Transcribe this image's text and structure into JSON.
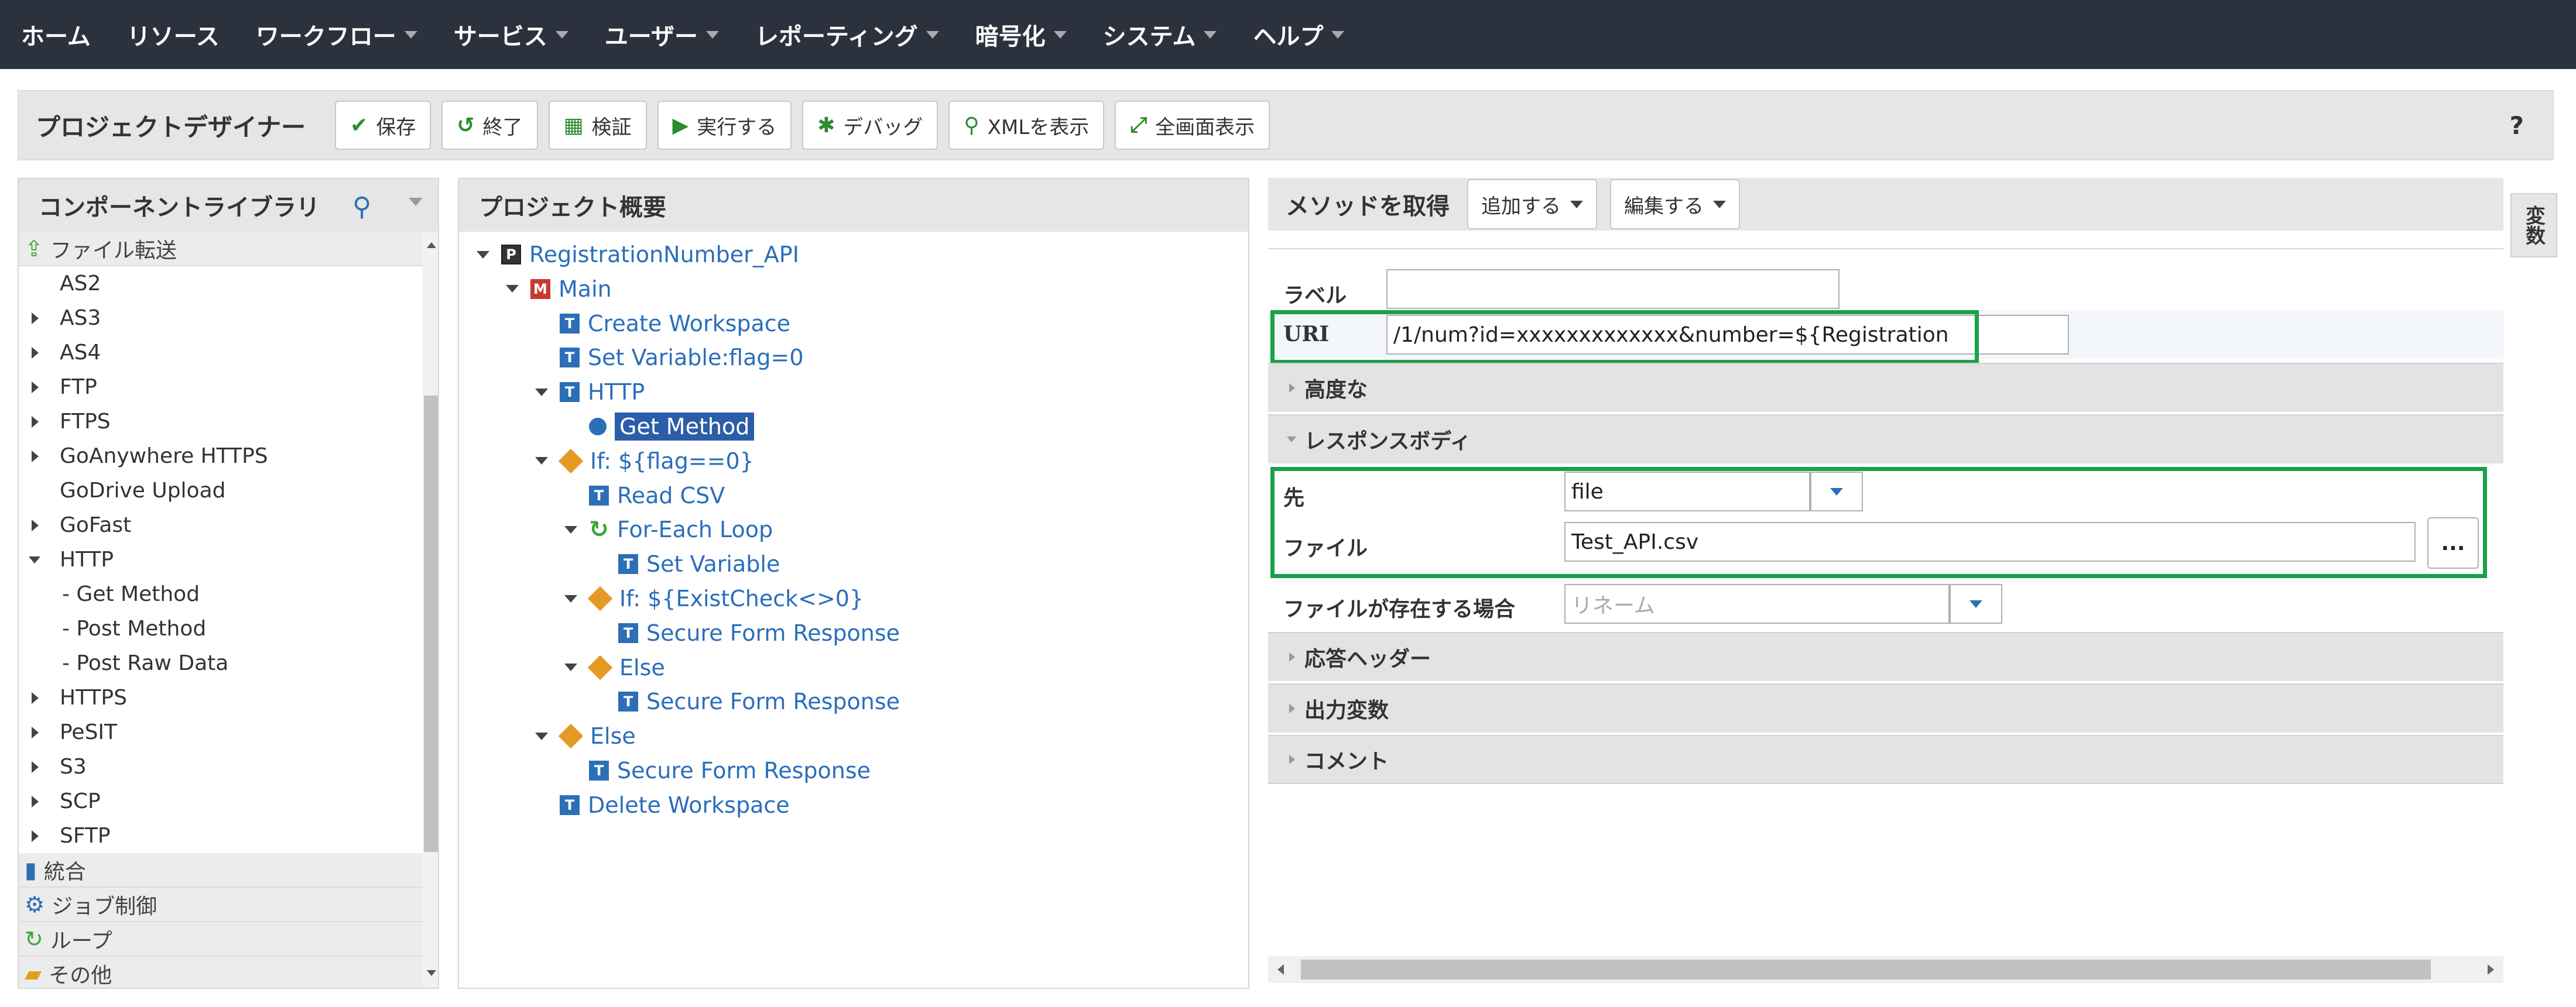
{
  "nav": {
    "items": [
      {
        "label": "ホーム",
        "dropdown": false
      },
      {
        "label": "リソース",
        "dropdown": false
      },
      {
        "label": "ワークフロー",
        "dropdown": true
      },
      {
        "label": "サービス",
        "dropdown": true
      },
      {
        "label": "ユーザー",
        "dropdown": true
      },
      {
        "label": "レポーティング",
        "dropdown": true
      },
      {
        "label": "暗号化",
        "dropdown": true
      },
      {
        "label": "システム",
        "dropdown": true
      },
      {
        "label": "ヘルプ",
        "dropdown": true
      }
    ]
  },
  "toolbar": {
    "title": "プロジェクトデザイナー",
    "buttons": [
      {
        "label": "保存",
        "icon": "check-icon",
        "glyph": "✔",
        "color": "#2e8b2e"
      },
      {
        "label": "終了",
        "icon": "undo-icon",
        "glyph": "↺",
        "color": "#2e8b2e"
      },
      {
        "label": "検証",
        "icon": "grid-icon",
        "glyph": "▦",
        "color": "#2e8b2e"
      },
      {
        "label": "実行する",
        "icon": "play-icon",
        "glyph": "▶",
        "color": "#2e8b2e"
      },
      {
        "label": "デバッグ",
        "icon": "bug-icon",
        "glyph": "✱",
        "color": "#2e8b2e"
      },
      {
        "label": "XMLを表示",
        "icon": "search-icon",
        "glyph": "⚲",
        "color": "#2e8b2e"
      },
      {
        "label": "全画面表示",
        "icon": "expand-icon",
        "glyph": "⤢",
        "color": "#2e8b2e"
      }
    ],
    "help": "?"
  },
  "library": {
    "title": "コンポーネントライブラリ",
    "top_group": "ファイル転送",
    "items": [
      {
        "label": "AS2",
        "toggle": "none"
      },
      {
        "label": "AS3",
        "toggle": "right"
      },
      {
        "label": "AS4",
        "toggle": "right"
      },
      {
        "label": "FTP",
        "toggle": "right"
      },
      {
        "label": "FTPS",
        "toggle": "right"
      },
      {
        "label": "GoAnywhere HTTPS",
        "toggle": "right"
      },
      {
        "label": "GoDrive Upload",
        "toggle": "none"
      },
      {
        "label": "GoFast",
        "toggle": "right"
      },
      {
        "label": "HTTP",
        "toggle": "down"
      },
      {
        "label": "- Get Method",
        "toggle": "child"
      },
      {
        "label": "- Post Method",
        "toggle": "child"
      },
      {
        "label": "- Post Raw Data",
        "toggle": "child"
      },
      {
        "label": "HTTPS",
        "toggle": "right"
      },
      {
        "label": "PeSIT",
        "toggle": "right"
      },
      {
        "label": "S3",
        "toggle": "right"
      },
      {
        "label": "SCP",
        "toggle": "right"
      },
      {
        "label": "SFTP",
        "toggle": "right"
      }
    ],
    "groups": [
      {
        "label": "統合",
        "icon": "phone-icon",
        "glyph": "▮",
        "color": "#2c6fb6"
      },
      {
        "label": "ジョブ制御",
        "icon": "gear-icon",
        "glyph": "⚙",
        "color": "#2c6fb6"
      },
      {
        "label": "ループ",
        "icon": "loop-icon",
        "glyph": "↻",
        "color": "#3aa63a"
      },
      {
        "label": "その他",
        "icon": "folder-icon",
        "glyph": "▰",
        "color": "#e0a020"
      }
    ]
  },
  "project": {
    "title": "プロジェクト概要",
    "nodes": [
      {
        "label": "RegistrationNumber_API",
        "icon": "p",
        "glyph": "P",
        "depth": 0,
        "toggle": true,
        "selected": false
      },
      {
        "label": "Main",
        "icon": "m",
        "glyph": "M",
        "depth": 1,
        "toggle": true,
        "selected": false
      },
      {
        "label": "Create Workspace",
        "icon": "t",
        "glyph": "T",
        "depth": 2,
        "toggle": false,
        "selected": false
      },
      {
        "label": "Set Variable:flag=0",
        "icon": "t",
        "glyph": "T",
        "depth": 2,
        "toggle": false,
        "selected": false
      },
      {
        "label": "HTTP",
        "icon": "t",
        "glyph": "T",
        "depth": 2,
        "toggle": true,
        "selected": false
      },
      {
        "label": "Get Method",
        "icon": "g",
        "glyph": "",
        "depth": 3,
        "toggle": false,
        "selected": true
      },
      {
        "label": "If: ${flag==0}",
        "icon": "d",
        "glyph": "",
        "depth": 2,
        "toggle": true,
        "selected": false
      },
      {
        "label": "Read CSV",
        "icon": "t",
        "glyph": "T",
        "depth": 3,
        "toggle": false,
        "selected": false
      },
      {
        "label": "For-Each Loop",
        "icon": "l",
        "glyph": "↻",
        "depth": 3,
        "toggle": true,
        "selected": false
      },
      {
        "label": "Set Variable",
        "icon": "t",
        "glyph": "T",
        "depth": 4,
        "toggle": false,
        "selected": false
      },
      {
        "label": "If: ${ExistCheck<>0}",
        "icon": "d",
        "glyph": "",
        "depth": 3,
        "toggle": true,
        "selected": false
      },
      {
        "label": "Secure Form Response",
        "icon": "t",
        "glyph": "T",
        "depth": 4,
        "toggle": false,
        "selected": false
      },
      {
        "label": "Else",
        "icon": "d",
        "glyph": "",
        "depth": 3,
        "toggle": true,
        "selected": false
      },
      {
        "label": "Secure Form Response",
        "icon": "t",
        "glyph": "T",
        "depth": 4,
        "toggle": false,
        "selected": false
      },
      {
        "label": "Else",
        "icon": "d",
        "glyph": "",
        "depth": 2,
        "toggle": true,
        "selected": false
      },
      {
        "label": "Secure Form Response",
        "icon": "t",
        "glyph": "T",
        "depth": 3,
        "toggle": false,
        "selected": false
      },
      {
        "label": "Delete Workspace",
        "icon": "t",
        "glyph": "T",
        "depth": 2,
        "toggle": false,
        "selected": false
      }
    ]
  },
  "props": {
    "title": "メソッドを取得",
    "add_label": "追加する",
    "edit_label": "編集する",
    "label_field": {
      "label": "ラベル",
      "value": ""
    },
    "uri_field": {
      "label": "URI",
      "value": "/1/num?id=xxxxxxxxxxxxx&number=${Registration"
    },
    "sections": {
      "advanced": "高度な",
      "response_body": "レスポンスボディ",
      "response_header": "応答ヘッダー",
      "output_vars": "出力変数",
      "comment": "コメント"
    },
    "dest_field": {
      "label": "先",
      "value": "file"
    },
    "file_field": {
      "label": "ファイル",
      "value": "Test_API.csv",
      "browse": "..."
    },
    "exists_field": {
      "label": "ファイルが存在する場合",
      "placeholder": "リネーム"
    }
  },
  "side_tab": "変数",
  "colors": {
    "highlight": "#1aa14a",
    "nav_bg": "#2c323d",
    "link": "#2a6ebb",
    "selection": "#2c5da8"
  }
}
